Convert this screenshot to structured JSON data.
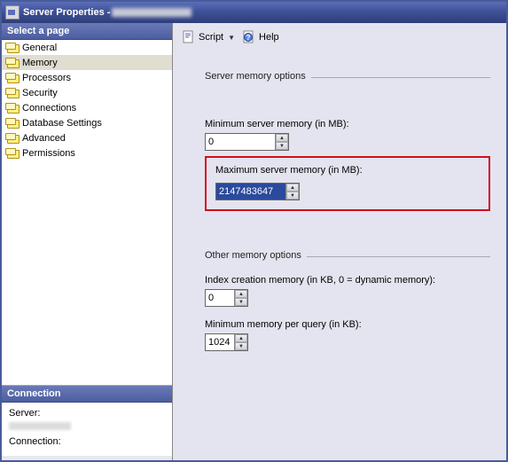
{
  "window": {
    "title_prefix": "Server Properties - "
  },
  "left": {
    "select_page": "Select a page",
    "pages": [
      "General",
      "Memory",
      "Processors",
      "Security",
      "Connections",
      "Database Settings",
      "Advanced",
      "Permissions"
    ],
    "selected_index": 1,
    "connection_header": "Connection",
    "server_label": "Server:",
    "connection_label": "Connection:"
  },
  "toolbar": {
    "script": "Script",
    "help": "Help"
  },
  "memory": {
    "server_memory_group": "Server memory options",
    "min_label": "Minimum server memory (in MB):",
    "min_value": "0",
    "max_label": "Maximum server memory (in MB):",
    "max_value": "2147483647",
    "other_group": "Other memory options",
    "index_label": "Index creation memory (in KB, 0 = dynamic memory):",
    "index_value": "0",
    "minq_label": "Minimum memory per query (in KB):",
    "minq_value": "1024"
  }
}
